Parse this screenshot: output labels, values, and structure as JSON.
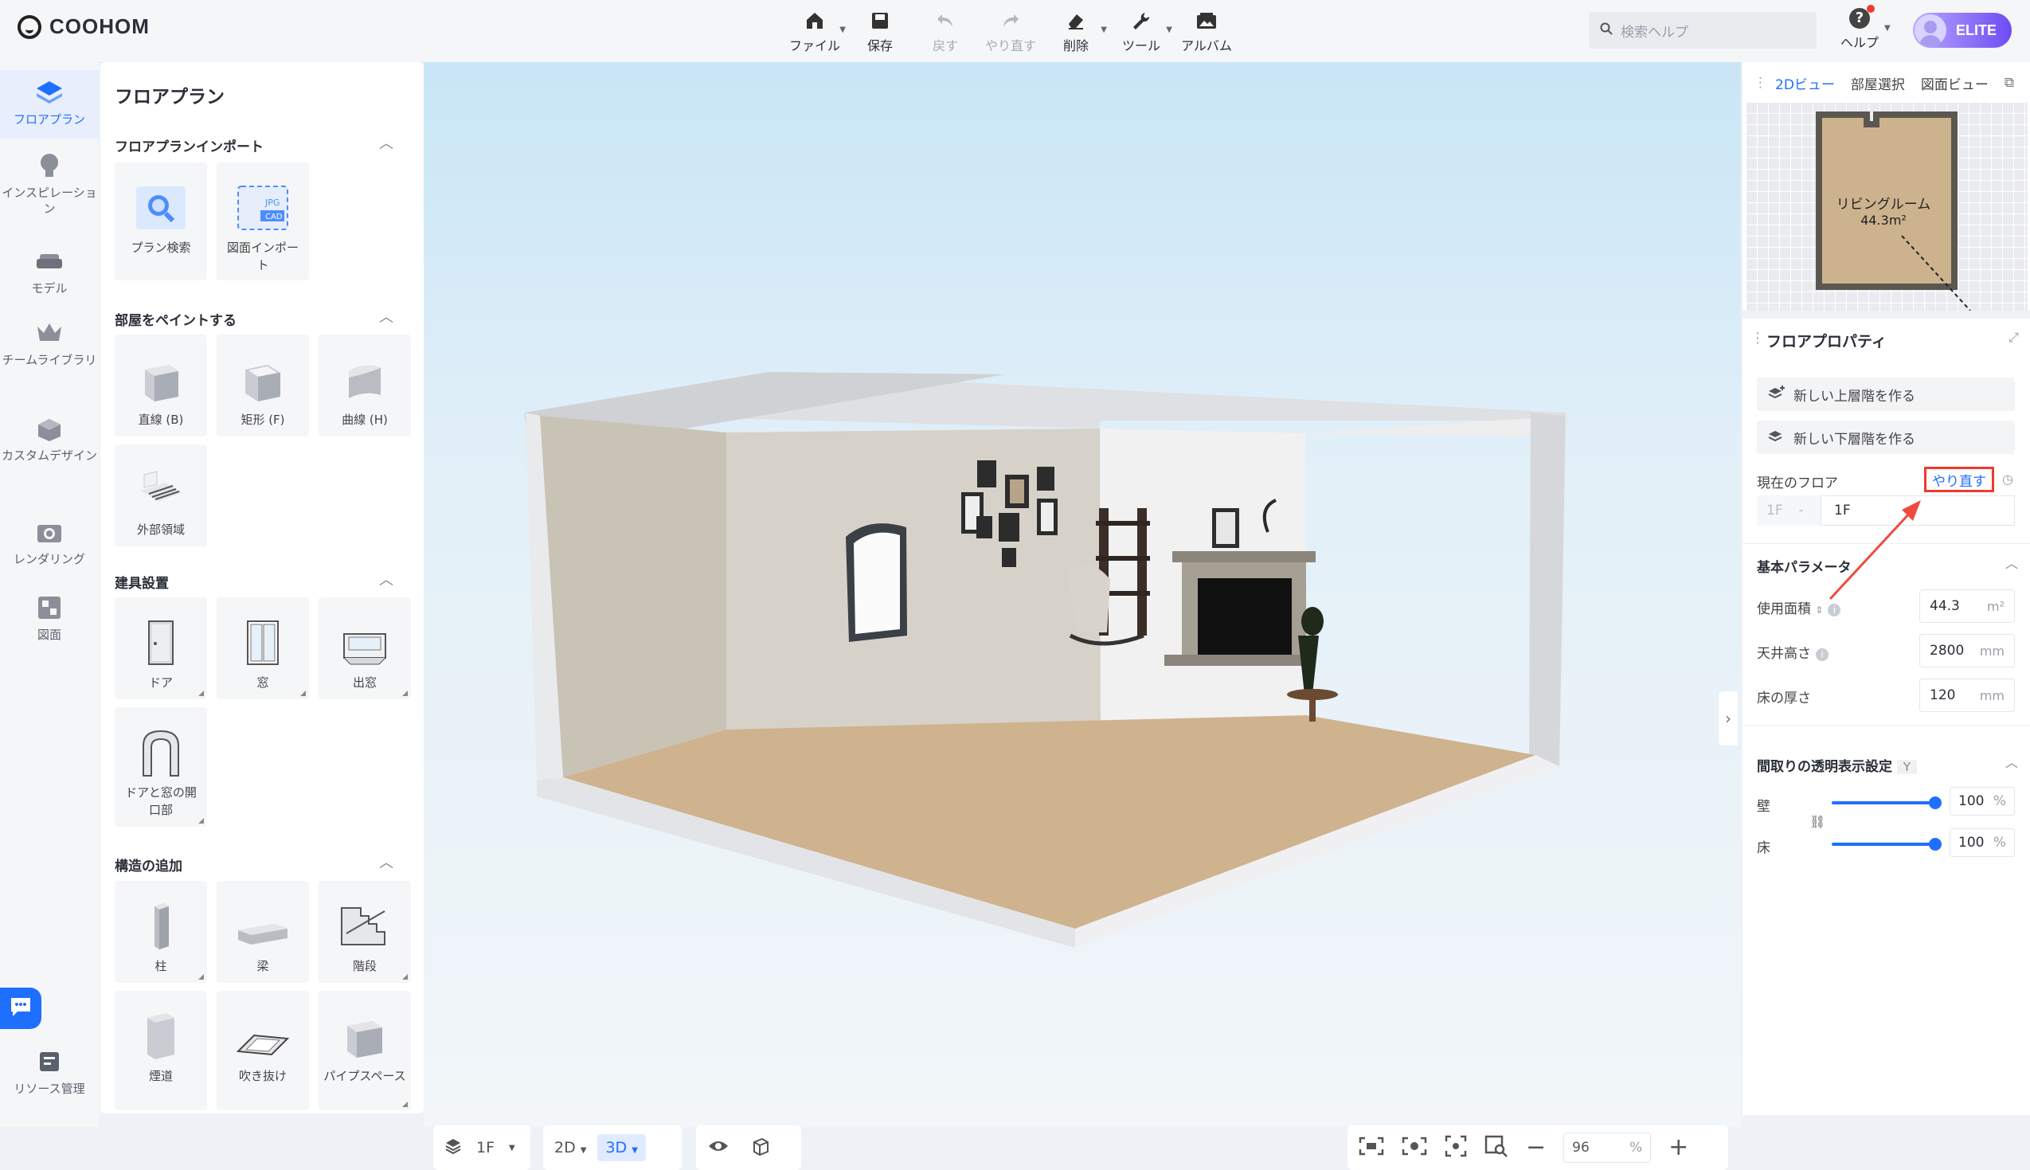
{
  "app": {
    "logo": "COOHOM"
  },
  "toolbar": {
    "file": "ファイル",
    "save": "保存",
    "undo": "戻す",
    "redo": "やり直す",
    "delete": "削除",
    "tools": "ツール",
    "album": "アルバム"
  },
  "search": {
    "placeholder": "検索ヘルプ"
  },
  "help": {
    "label": "ヘルプ",
    "glyph": "?"
  },
  "account": {
    "badge": "ELITE"
  },
  "leftnav": {
    "items": [
      {
        "label": "フロアプラン"
      },
      {
        "label": "インスピレーション"
      },
      {
        "label": "モデル"
      },
      {
        "label": "チームライブラリ"
      },
      {
        "label": "カスタムデザイン"
      },
      {
        "label": "レンダリング"
      },
      {
        "label": "図面"
      }
    ],
    "resource": "リソース管理"
  },
  "panel": {
    "title": "フロアプラン",
    "sections": [
      {
        "title": "フロアプランインポート",
        "items": [
          "プラン検索",
          "図面インポート"
        ]
      },
      {
        "title": "部屋をペイントする",
        "items": [
          "直線 (B)",
          "矩形 (F)",
          "曲線 (H)",
          "外部領域"
        ]
      },
      {
        "title": "建具設置",
        "items": [
          "ドア",
          "窓",
          "出窓",
          "ドアと窓の開口部"
        ]
      },
      {
        "title": "構造の追加",
        "items": [
          "柱",
          "梁",
          "階段",
          "煙道",
          "吹き抜け",
          "パイプスペース"
        ]
      }
    ],
    "import_thumb_text": [
      "JPG",
      "CAD"
    ]
  },
  "canvas_bottom": {
    "floor": "1F",
    "view2d": "2D",
    "view3d": "3D",
    "zoom": "96",
    "zoom_unit": "%"
  },
  "right_top": {
    "tabs": [
      "2Dビュー",
      "部屋選択",
      "図面ビュー"
    ],
    "room_name": "リビングルーム",
    "room_area": "44.3m²"
  },
  "floor_props": {
    "title": "フロアプロパティ",
    "new_upper": "新しい上層階を作る",
    "new_lower": "新しい下層階を作る",
    "current_floor_label": "現在のフロア",
    "redo_link": "やり直す",
    "floor_left": "1F",
    "floor_dash": "-",
    "floor_right": "1F",
    "basic_params": "基本パラメータ",
    "area_label": "使用面積",
    "area_value": "44.3",
    "area_unit": "m²",
    "ceiling_label": "天井高さ",
    "ceiling_value": "2800",
    "ceiling_unit": "mm",
    "floor_thick_label": "床の厚さ",
    "floor_thick_value": "120",
    "floor_thick_unit": "mm",
    "transparency": "間取りの透明表示設定",
    "transparency_key": "Y",
    "wall_label": "壁",
    "wall_value": "100",
    "wall_level": 1.0,
    "floor_label": "床",
    "floor_value": "100",
    "floor_level": 1.0,
    "pct": "%"
  },
  "colors": {
    "accent": "#1f6fff",
    "highlight": "#f03a2e",
    "elite_gradient_end": "#6d4cf2"
  }
}
